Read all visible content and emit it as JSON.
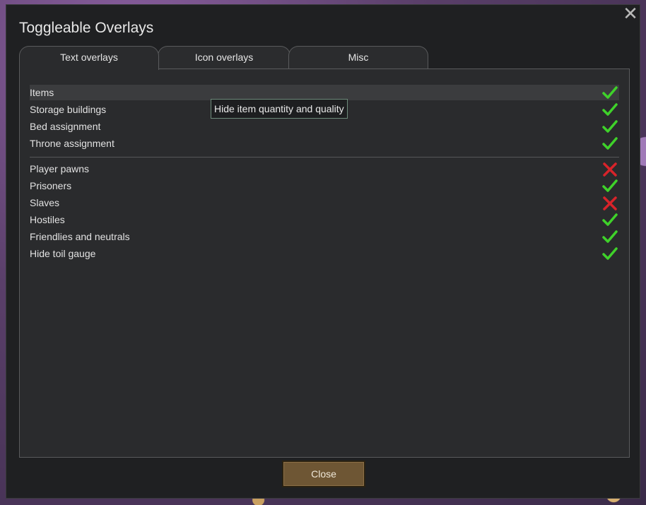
{
  "window": {
    "title": "Toggleable Overlays",
    "close_icon": "close-icon"
  },
  "tabs": [
    {
      "label": "Text overlays",
      "active": true
    },
    {
      "label": "Icon overlays",
      "active": false
    },
    {
      "label": "Misc",
      "active": false
    }
  ],
  "group1": [
    {
      "label": "Items",
      "checked": true
    },
    {
      "label": "Storage buildings",
      "checked": true
    },
    {
      "label": "Bed assignment",
      "checked": true
    },
    {
      "label": "Throne assignment",
      "checked": true
    }
  ],
  "group2": [
    {
      "label": "Player pawns",
      "checked": false
    },
    {
      "label": "Prisoners",
      "checked": true
    },
    {
      "label": "Slaves",
      "checked": false
    },
    {
      "label": "Hostiles",
      "checked": true
    },
    {
      "label": "Friendlies and neutrals",
      "checked": true
    },
    {
      "label": "Hide toil gauge",
      "checked": true
    }
  ],
  "tooltip": {
    "text": "Hide item quantity and quality"
  },
  "footer": {
    "close_label": "Close"
  },
  "colors": {
    "check": "#3fd22a",
    "cross": "#d8232a",
    "button": "#6e5634"
  }
}
